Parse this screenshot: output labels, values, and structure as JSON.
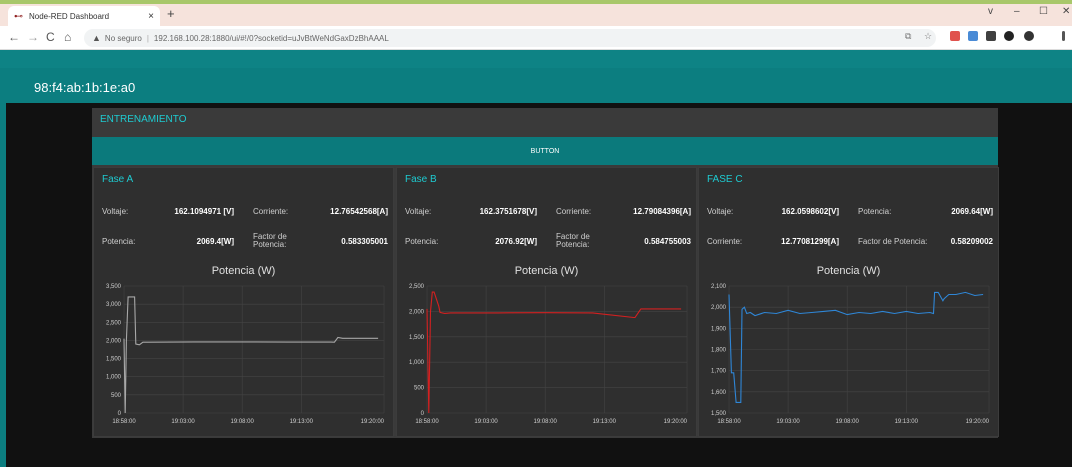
{
  "browser": {
    "tab_title": "Node-RED Dashboard",
    "tab_close": "×",
    "new_tab": "+",
    "address_security": "No seguro",
    "address_url": "192.168.100.28:1880/ui/#!/0?socketid=uJvBtWeNdGaxDzBhAAAL",
    "window_controls": [
      "v",
      "–",
      "☐",
      "✕"
    ],
    "nav": {
      "back": "←",
      "forward": "→",
      "reload": "C",
      "home": "⌂"
    }
  },
  "header": {
    "title": "98:f4:ab:1b:1e:a0"
  },
  "group": {
    "title": "ENTRENAMIENTO"
  },
  "button": {
    "label": "BUTTON"
  },
  "panels": [
    {
      "title": "Fase A",
      "rows": [
        [
          "Voltaje:",
          "162.1094971 [V]",
          "Corriente:",
          "12.76542568[A]"
        ],
        [
          "Potencia:",
          "2069.4[W]",
          "Factor de Potencia:",
          "0.583305001"
        ]
      ],
      "chart_title": "Potencia (W)",
      "color": "#a8a8a8"
    },
    {
      "title": "Fase B",
      "rows": [
        [
          "Voltaje:",
          "162.3751678[V]",
          "Corriente:",
          "12.79084396[A]"
        ],
        [
          "Potencia:",
          "2076.92[W]",
          "Factor de Potencia:",
          "0.584755003"
        ]
      ],
      "chart_title": "Potencia (W)",
      "color": "#d42020"
    },
    {
      "title": "FASE C",
      "rows": [
        [
          "Voltaje:",
          "162.0598602[V]",
          "Potencia:",
          "2069.64[W]"
        ],
        [
          "Corriente:",
          "12.77081299[A]",
          "Factor de Potencia:",
          "0.58209002"
        ]
      ],
      "chart_title": "Potencia (W)",
      "color": "#2f86d6"
    }
  ],
  "chart_data": [
    {
      "type": "line",
      "title": "Potencia (W)",
      "x_ticks": [
        "18:58:00",
        "19:03:00",
        "19:08:00",
        "19:13:00",
        "19:20:00"
      ],
      "y_ticks": [
        0,
        500,
        1000,
        1500,
        2000,
        2500,
        3000,
        3500
      ],
      "y_tick_labels": [
        "0",
        "500",
        "1,000",
        "1,500",
        "2,000",
        "2,500",
        "3,000",
        "3,500"
      ],
      "ylim": [
        0,
        3500
      ],
      "xlim_minutes": [
        0,
        22
      ],
      "series": [
        {
          "x": [
            0,
            0.1,
            0.2,
            0.35,
            0.5,
            0.9,
            1.0,
            1.3,
            1.6,
            2.0,
            6,
            10,
            14,
            17.5,
            17.8,
            18.1,
            18.5,
            21.5
          ],
          "y": [
            2050,
            0,
            2000,
            3200,
            3200,
            3200,
            1900,
            1880,
            1950,
            1950,
            1960,
            1960,
            1955,
            1955,
            1950,
            2080,
            2060,
            2060
          ]
        }
      ]
    },
    {
      "type": "line",
      "title": "Potencia (W)",
      "x_ticks": [
        "18:58:00",
        "19:03:00",
        "19:08:00",
        "19:13:00",
        "19:20:00"
      ],
      "y_ticks": [
        0,
        500,
        1000,
        1500,
        2000,
        2500
      ],
      "y_tick_labels": [
        "0",
        "500",
        "1,000",
        "1,500",
        "2,000",
        "2,500"
      ],
      "ylim": [
        0,
        2500
      ],
      "xlim_minutes": [
        0,
        22
      ],
      "series": [
        {
          "x": [
            0,
            0.15,
            0.3,
            0.45,
            0.6,
            1.0,
            1.1,
            1.5,
            2.0,
            6,
            10,
            14,
            17.5,
            17.6,
            18.1,
            21.5
          ],
          "y": [
            2050,
            0,
            2000,
            2380,
            2380,
            2100,
            1980,
            1960,
            1970,
            1970,
            1975,
            1970,
            1880,
            1880,
            2050,
            2050
          ]
        }
      ]
    },
    {
      "type": "line",
      "title": "Potencia (W)",
      "x_ticks": [
        "18:58:00",
        "19:03:00",
        "19:08:00",
        "19:13:00",
        "19:20:00"
      ],
      "y_ticks": [
        1500,
        1600,
        1700,
        1800,
        1900,
        2000,
        2100
      ],
      "y_tick_labels": [
        "1,500",
        "1,600",
        "1,700",
        "1,800",
        "1,900",
        "2,000",
        "2,100"
      ],
      "ylim": [
        1500,
        2100
      ],
      "xlim_minutes": [
        0,
        22
      ],
      "series": [
        {
          "x": [
            0,
            0.2,
            0.3,
            0.4,
            0.6,
            1.0,
            1.1,
            1.3,
            1.5,
            1.8,
            2.2,
            3,
            4,
            5,
            6,
            7,
            8,
            9,
            10,
            11,
            12,
            13,
            14,
            15,
            16,
            17,
            17.3,
            17.4,
            17.7,
            18.1,
            18.2,
            18.6,
            19.2,
            20,
            20.8,
            21.5
          ],
          "y": [
            2060,
            1690,
            1690,
            1690,
            1550,
            1550,
            1990,
            2000,
            1970,
            1975,
            1960,
            1975,
            1970,
            1985,
            1970,
            1975,
            1980,
            1985,
            1965,
            1975,
            1970,
            1980,
            1970,
            1980,
            1970,
            1975,
            1970,
            2070,
            2070,
            2030,
            2040,
            2060,
            2060,
            2070,
            2055,
            2060
          ]
        }
      ]
    }
  ]
}
